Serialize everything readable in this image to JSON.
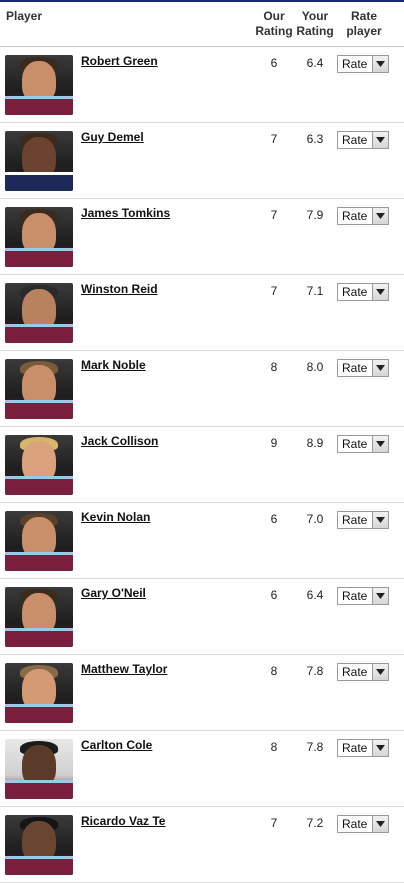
{
  "headers": {
    "player": "Player",
    "our_rating": "Our Rating",
    "your_rating": "Your Rating",
    "rate_player": "Rate player"
  },
  "players": [
    {
      "name": "Robert Green",
      "our": "6",
      "your": "6.4",
      "rate": "Rate"
    },
    {
      "name": "Guy Demel",
      "our": "7",
      "your": "6.3",
      "rate": "Rate"
    },
    {
      "name": "James Tomkins",
      "our": "7",
      "your": "7.9",
      "rate": "Rate"
    },
    {
      "name": "Winston Reid",
      "our": "7",
      "your": "7.1",
      "rate": "Rate"
    },
    {
      "name": "Mark Noble",
      "our": "8",
      "your": "8.0",
      "rate": "Rate"
    },
    {
      "name": "Jack Collison",
      "our": "9",
      "your": "8.9",
      "rate": "Rate"
    },
    {
      "name": "Kevin Nolan",
      "our": "6",
      "your": "7.0",
      "rate": "Rate"
    },
    {
      "name": "Gary O'Neil",
      "our": "6",
      "your": "6.4",
      "rate": "Rate"
    },
    {
      "name": "Matthew Taylor",
      "our": "8",
      "your": "7.8",
      "rate": "Rate"
    },
    {
      "name": "Carlton Cole",
      "our": "8",
      "your": "7.8",
      "rate": "Rate"
    },
    {
      "name": "Ricardo Vaz Te",
      "our": "7",
      "your": "7.2",
      "rate": "Rate"
    }
  ],
  "icons": {
    "dropdown": "chevron-down-icon",
    "photo": "player-photo"
  },
  "colors": {
    "header_border": "#1b2a6b",
    "shirt": "#7a1f3d",
    "shirt_trim": "#9ec6e6"
  }
}
